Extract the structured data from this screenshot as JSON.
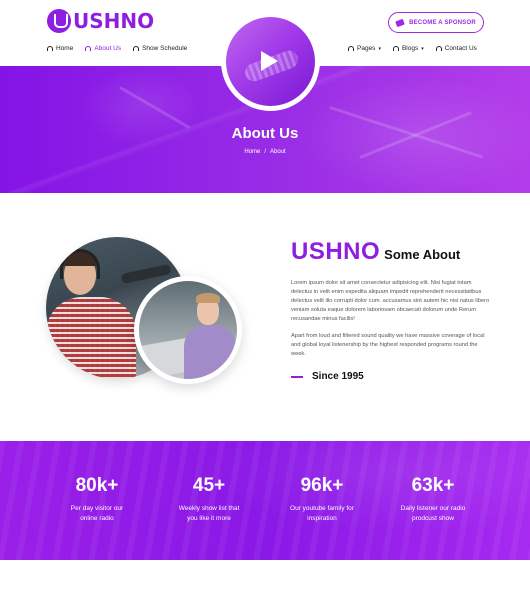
{
  "brand": {
    "logo_text": "USHNO",
    "accent_color": "#8e1ee0"
  },
  "header": {
    "sponsor_button": "BECOME A SPONSOR",
    "nav_left": [
      {
        "label": "Home",
        "icon": "headphones-icon",
        "active": false
      },
      {
        "label": "About Us",
        "icon": "headphones-icon",
        "active": true
      },
      {
        "label": "Show Schedule",
        "icon": "headphones-icon",
        "active": false
      }
    ],
    "nav_right": [
      {
        "label": "Pages",
        "icon": "headphones-icon",
        "has_dropdown": true
      },
      {
        "label": "Blogs",
        "icon": "headphones-icon",
        "has_dropdown": true
      },
      {
        "label": "Contact Us",
        "icon": "headphones-icon",
        "has_dropdown": false
      }
    ]
  },
  "hero": {
    "title": "About Us",
    "breadcrumb": [
      "Home",
      "/",
      "About"
    ],
    "play_icon": "play-icon"
  },
  "about": {
    "brand": "USHNO",
    "subtitle": "Some About",
    "paragraph1": "Lorem ipsum dolor sit amet consectetur adipisicing elit. Nisi fugiat totam delectus in velit enim expedita aliquam impedit reprehenderit necessitatibus delectus velit illo corrupti dolor cum. accusamus sint autem hic nisi natus libero veniam soluta eaque dolorem laboriosam obcaecati dolorum unde Rerum recusandae minus facilis!",
    "paragraph2": "Apart from loud and filtered sound quality we have massive coverage of local and global loyal listenership by the highest responded programs round the week.",
    "since": "Since 1995"
  },
  "stats": [
    {
      "number": "80k+",
      "label_line1": "Per day visitor our",
      "label_line2": "online radio"
    },
    {
      "number": "45+",
      "label_line1": "Weekly show list that",
      "label_line2": "you like it more"
    },
    {
      "number": "96k+",
      "label_line1": "Our youtube family for",
      "label_line2": "inspiration"
    },
    {
      "number": "63k+",
      "label_line1": "Daily listener our radio",
      "label_line2": "prodcust show"
    }
  ]
}
